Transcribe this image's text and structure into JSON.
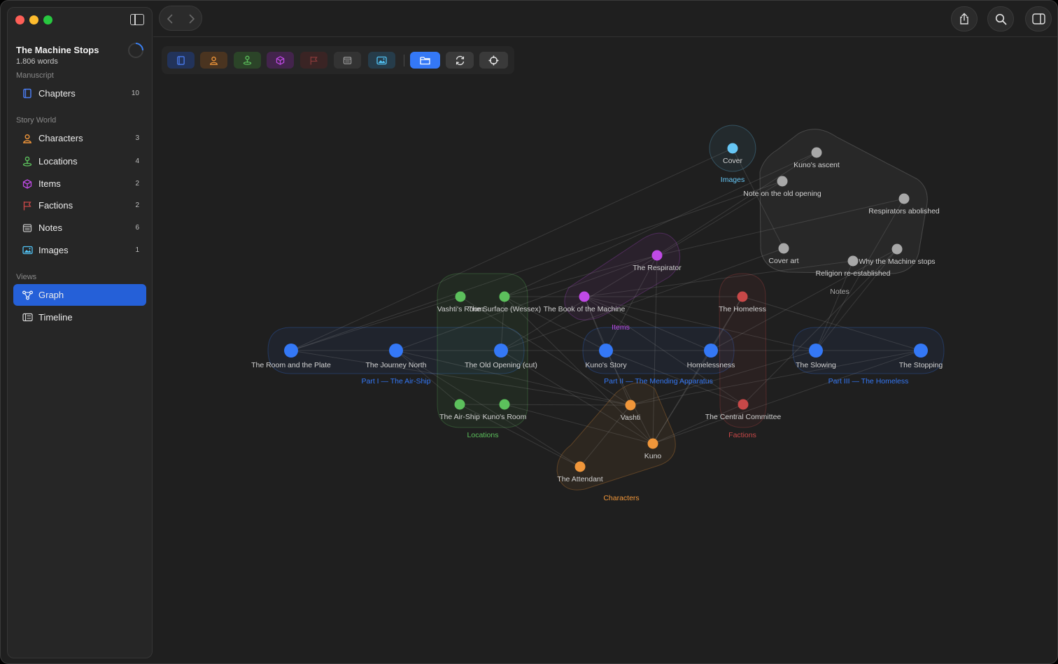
{
  "project": {
    "title": "The Machine Stops",
    "words": "1.806 words"
  },
  "sidebar": {
    "sections": {
      "manuscript": "Manuscript",
      "story_world": "Story World",
      "views": "Views"
    },
    "items": [
      {
        "label": "Chapters",
        "count": "10",
        "icon": "book-icon",
        "color": "#4a7cf0"
      },
      {
        "label": "Characters",
        "count": "3",
        "icon": "person-icon",
        "color": "#f0963a"
      },
      {
        "label": "Locations",
        "count": "4",
        "icon": "location-pin-icon",
        "color": "#5cc05c"
      },
      {
        "label": "Items",
        "count": "2",
        "icon": "cube-icon",
        "color": "#c04ae6"
      },
      {
        "label": "Factions",
        "count": "2",
        "icon": "flag-icon",
        "color": "#c84848"
      },
      {
        "label": "Notes",
        "count": "6",
        "icon": "note-icon",
        "color": "#c0c0c0"
      },
      {
        "label": "Images",
        "count": "1",
        "icon": "image-icon",
        "color": "#52c3f5"
      }
    ],
    "views": [
      {
        "label": "Graph",
        "icon": "graph-icon",
        "active": true
      },
      {
        "label": "Timeline",
        "icon": "timeline-icon",
        "active": false
      }
    ]
  },
  "toolbar": {
    "filters": [
      {
        "icon": "book-icon",
        "color": "#4a7cf0"
      },
      {
        "icon": "person-icon",
        "color": "#f0963a"
      },
      {
        "icon": "location-pin-icon",
        "color": "#5cc05c"
      },
      {
        "icon": "cube-icon",
        "color": "#c04ae6"
      },
      {
        "icon": "flag-icon",
        "color": "#c84848"
      },
      {
        "icon": "note-icon",
        "color": "#9a9a9a"
      },
      {
        "icon": "image-icon",
        "color": "#52c3f5"
      }
    ],
    "actions": [
      {
        "icon": "folder-icon",
        "active": true
      },
      {
        "icon": "refresh-icon",
        "active": false
      },
      {
        "icon": "crosshair-icon",
        "active": false
      }
    ]
  },
  "graph": {
    "colors": {
      "chapter": "#3478f6",
      "character": "#f0963a",
      "location": "#5cc05c",
      "item": "#c04ae6",
      "faction": "#c84848",
      "note": "#a8a8a8",
      "image": "#66c6f5"
    },
    "clusters": [
      {
        "id": "part1",
        "label": "Part I — The Air-Ship",
        "color": "#3478f6"
      },
      {
        "id": "part2",
        "label": "Part II — The Mending Apparatus",
        "color": "#3478f6"
      },
      {
        "id": "part3",
        "label": "Part III — The Homeless",
        "color": "#3478f6"
      },
      {
        "id": "locations",
        "label": "Locations",
        "color": "#5cc05c"
      },
      {
        "id": "items",
        "label": "Items",
        "color": "#c04ae6"
      },
      {
        "id": "factions",
        "label": "Factions",
        "color": "#c84848"
      },
      {
        "id": "characters",
        "label": "Characters",
        "color": "#f0963a"
      },
      {
        "id": "notes",
        "label": "Notes",
        "color": "#a8a8a8"
      },
      {
        "id": "images",
        "label": "Images",
        "color": "#66c6f5"
      }
    ],
    "nodes": [
      {
        "id": "ch1",
        "label": "The Room and the Plate",
        "kind": "chapter"
      },
      {
        "id": "ch2",
        "label": "The Journey North",
        "kind": "chapter"
      },
      {
        "id": "ch3",
        "label": "The Old Opening (cut)",
        "kind": "chapter"
      },
      {
        "id": "ch4",
        "label": "Kuno's Story",
        "kind": "chapter"
      },
      {
        "id": "ch5",
        "label": "Homelessness",
        "kind": "chapter"
      },
      {
        "id": "ch6",
        "label": "The Slowing",
        "kind": "chapter"
      },
      {
        "id": "ch7",
        "label": "The Stopping",
        "kind": "chapter"
      },
      {
        "id": "loc1",
        "label": "Vashti's Room",
        "kind": "location"
      },
      {
        "id": "loc2",
        "label": "The Surface (Wessex)",
        "kind": "location"
      },
      {
        "id": "loc3",
        "label": "The Air-Ship",
        "kind": "location"
      },
      {
        "id": "loc4",
        "label": "Kuno's Room",
        "kind": "location"
      },
      {
        "id": "it1",
        "label": "The Respirator",
        "kind": "item"
      },
      {
        "id": "it2",
        "label": "The Book of the Machine",
        "kind": "item"
      },
      {
        "id": "fa1",
        "label": "The Homeless",
        "kind": "faction"
      },
      {
        "id": "fa2",
        "label": "The Central Committee",
        "kind": "faction"
      },
      {
        "id": "cr1",
        "label": "Vashti",
        "kind": "character"
      },
      {
        "id": "cr2",
        "label": "Kuno",
        "kind": "character"
      },
      {
        "id": "cr3",
        "label": "The Attendant",
        "kind": "character"
      },
      {
        "id": "no1",
        "label": "Kuno's ascent",
        "kind": "note"
      },
      {
        "id": "no2",
        "label": "Note on the old opening",
        "kind": "note"
      },
      {
        "id": "no3",
        "label": "Respirators abolished",
        "kind": "note"
      },
      {
        "id": "no4",
        "label": "Cover art",
        "kind": "note"
      },
      {
        "id": "no5",
        "label": "Why the Machine stops",
        "kind": "note"
      },
      {
        "id": "no6",
        "label": "Religion re-established",
        "kind": "note"
      },
      {
        "id": "im1",
        "label": "Cover",
        "kind": "image"
      }
    ],
    "edges": [
      [
        "ch1",
        "ch2"
      ],
      [
        "ch2",
        "ch3"
      ],
      [
        "ch3",
        "ch4"
      ],
      [
        "ch4",
        "ch5"
      ],
      [
        "ch5",
        "ch6"
      ],
      [
        "ch6",
        "ch7"
      ],
      [
        "ch1",
        "loc1"
      ],
      [
        "ch1",
        "cr1"
      ],
      [
        "ch2",
        "loc3"
      ],
      [
        "ch2",
        "cr1"
      ],
      [
        "ch2",
        "cr3"
      ],
      [
        "ch3",
        "loc2"
      ],
      [
        "ch3",
        "cr2"
      ],
      [
        "ch4",
        "cr2"
      ],
      [
        "ch4",
        "loc2"
      ],
      [
        "ch4",
        "it1"
      ],
      [
        "ch4",
        "it2"
      ],
      [
        "ch4",
        "fa2"
      ],
      [
        "ch5",
        "cr2"
      ],
      [
        "ch5",
        "fa1"
      ],
      [
        "ch5",
        "it2"
      ],
      [
        "ch6",
        "cr1"
      ],
      [
        "ch6",
        "it2"
      ],
      [
        "ch6",
        "no5"
      ],
      [
        "ch6",
        "no6"
      ],
      [
        "ch6",
        "no3"
      ],
      [
        "ch7",
        "fa1"
      ],
      [
        "ch7",
        "cr2"
      ],
      [
        "ch7",
        "cr1"
      ],
      [
        "cr1",
        "loc1"
      ],
      [
        "cr1",
        "loc3"
      ],
      [
        "cr1",
        "it2"
      ],
      [
        "cr1",
        "cr3"
      ],
      [
        "cr2",
        "loc4"
      ],
      [
        "cr2",
        "loc2"
      ],
      [
        "cr2",
        "it1"
      ],
      [
        "cr2",
        "fa2"
      ],
      [
        "cr3",
        "loc3"
      ],
      [
        "fa1",
        "loc2"
      ],
      [
        "fa1",
        "cr2"
      ],
      [
        "fa2",
        "it2"
      ],
      [
        "it1",
        "no3"
      ],
      [
        "it1",
        "loc2"
      ],
      [
        "it1",
        "no1"
      ],
      [
        "no2",
        "ch3"
      ],
      [
        "no1",
        "loc2"
      ],
      [
        "no4",
        "im1"
      ],
      [
        "no5",
        "fa2"
      ],
      [
        "no6",
        "it2"
      ],
      [
        "im1",
        "ch1"
      ],
      [
        "ch1",
        "no2"
      ],
      [
        "ch2",
        "it1"
      ],
      [
        "ch5",
        "no5"
      ],
      [
        "ch3",
        "no4"
      ]
    ]
  }
}
